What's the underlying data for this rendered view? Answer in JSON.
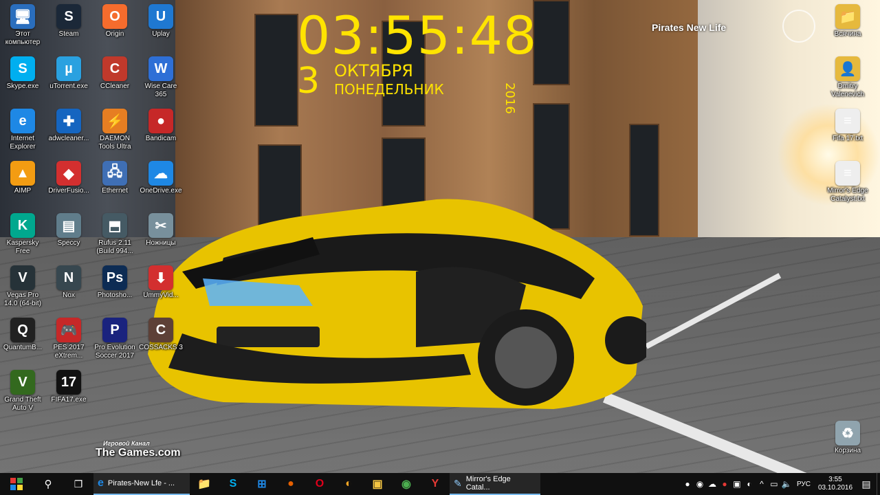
{
  "desktop": {
    "icons_left": [
      {
        "id": "this-pc",
        "label": "Этот компьютер",
        "glyph": "🖥",
        "color": "#2a6ebd"
      },
      {
        "id": "steam",
        "label": "Steam",
        "glyph": "S",
        "color": "#1b2838"
      },
      {
        "id": "origin",
        "label": "Origin",
        "glyph": "O",
        "color": "#f56c2d"
      },
      {
        "id": "uplay",
        "label": "Uplay",
        "glyph": "U",
        "color": "#1f78d1"
      },
      {
        "id": "skype",
        "label": "Skype.exe",
        "glyph": "S",
        "color": "#00aff0"
      },
      {
        "id": "utorrent",
        "label": "uTorrent.exe",
        "glyph": "µ",
        "color": "#2aa1e0"
      },
      {
        "id": "ccleaner",
        "label": "CCleaner",
        "glyph": "C",
        "color": "#c0392b"
      },
      {
        "id": "wisecare",
        "label": "Wise Care 365",
        "glyph": "W",
        "color": "#2e6fd6"
      },
      {
        "id": "ie",
        "label": "Internet Explorer",
        "glyph": "e",
        "color": "#1e88e5"
      },
      {
        "id": "adwcleaner",
        "label": "adwcleaner...",
        "glyph": "✚",
        "color": "#1565c0"
      },
      {
        "id": "daemon",
        "label": "DAEMON Tools Ultra",
        "glyph": "⚡",
        "color": "#e67e22"
      },
      {
        "id": "bandicam",
        "label": "Bandicam",
        "glyph": "●",
        "color": "#c62828"
      },
      {
        "id": "aimp",
        "label": "AIMP",
        "glyph": "▲",
        "color": "#f39c12"
      },
      {
        "id": "driverfusion",
        "label": "DriverFusio...",
        "glyph": "◆",
        "color": "#d32f2f"
      },
      {
        "id": "ethernet",
        "label": "Ethernet",
        "glyph": "🖧",
        "color": "#3f6fb5"
      },
      {
        "id": "onedrive",
        "label": "OneDrive.exe",
        "glyph": "☁",
        "color": "#1e88e5"
      },
      {
        "id": "kaspersky",
        "label": "Kaspersky Free",
        "glyph": "K",
        "color": "#00a88e"
      },
      {
        "id": "speccy",
        "label": "Speccy",
        "glyph": "▤",
        "color": "#607d8b"
      },
      {
        "id": "rufus",
        "label": "Rufus 2.11 (Build 994...",
        "glyph": "⬒",
        "color": "#455a64"
      },
      {
        "id": "scissors",
        "label": "Ножницы",
        "glyph": "✂",
        "color": "#78909c"
      },
      {
        "id": "vegas",
        "label": "Vegas Pro 14.0 (64-bit)",
        "glyph": "V",
        "color": "#263238"
      },
      {
        "id": "nox",
        "label": "Nox",
        "glyph": "N",
        "color": "#37474f"
      },
      {
        "id": "photoshop",
        "label": "Photosho...",
        "glyph": "Ps",
        "color": "#0d2c54"
      },
      {
        "id": "ummy",
        "label": "UmmyVid...",
        "glyph": "⬇",
        "color": "#d32f2f"
      },
      {
        "id": "quantum",
        "label": "QuantumB...",
        "glyph": "Q",
        "color": "#212121"
      },
      {
        "id": "pes2017",
        "label": "PES 2017 eXtrem...",
        "glyph": "🎮",
        "color": "#c62828"
      },
      {
        "id": "pes",
        "label": "Pro Evolution Soccer 2017",
        "glyph": "P",
        "color": "#1a237e"
      },
      {
        "id": "cossacks",
        "label": "COSSACKS 3",
        "glyph": "C",
        "color": "#5d4037"
      },
      {
        "id": "gta",
        "label": "Grand Theft Auto V",
        "glyph": "V",
        "color": "#33691e"
      },
      {
        "id": "fifa",
        "label": "FIFA17.exe",
        "glyph": "17",
        "color": "#111111"
      }
    ],
    "icons_right": [
      {
        "id": "vsyachina",
        "label": "Всячина",
        "glyph": "📁",
        "color": "#e6b93d"
      },
      {
        "id": "user-folder",
        "label": "Dmitry Valenevich",
        "glyph": "👤",
        "color": "#e6b93d"
      },
      {
        "id": "fifa-txt",
        "label": "Fifa 17.txt",
        "glyph": "≡",
        "color": "#eeeeee"
      },
      {
        "id": "mirrors-txt",
        "label": "Mirror's Edge Catalyst.txt",
        "glyph": "≡",
        "color": "#eeeeee"
      },
      {
        "id": "recycle",
        "label": "Корзина",
        "glyph": "♻",
        "color": "#90a4ae"
      }
    ]
  },
  "clock_widget": {
    "time": "03:55:48",
    "day": "3",
    "month": "ОКТЯБРЯ",
    "weekday": "ПОНЕДЕЛЬНИК",
    "year": "2016"
  },
  "overlay_text": {
    "pirates": "Pirates New Life",
    "watermark_small": "Игровой Канал",
    "watermark_big": "The Games.com"
  },
  "taskbar": {
    "tasks": [
      {
        "id": "pirates-task",
        "label": "Pirates-New Lfe - ...",
        "glyph": "e",
        "color": "#1e88e5"
      },
      {
        "id": "mirrors-task",
        "label": "Mirror's Edge Catal...",
        "glyph": "✎",
        "color": "#90caf9"
      }
    ],
    "pinned": [
      {
        "id": "explorer",
        "glyph": "📁",
        "color": "#f4c542"
      },
      {
        "id": "skype",
        "glyph": "S",
        "color": "#00aff0"
      },
      {
        "id": "store",
        "glyph": "⊞",
        "color": "#1e88e5"
      },
      {
        "id": "firefox",
        "glyph": "●",
        "color": "#e66000"
      },
      {
        "id": "opera",
        "glyph": "O",
        "color": "#e0001b"
      },
      {
        "id": "palette",
        "glyph": "◐",
        "color": "#f9a825"
      },
      {
        "id": "folder2",
        "glyph": "▣",
        "color": "#f4c542"
      },
      {
        "id": "chrome",
        "glyph": "◉",
        "color": "#4caf50"
      },
      {
        "id": "yandex",
        "glyph": "Y",
        "color": "#e53935"
      }
    ],
    "tray": {
      "language": "РУС",
      "time": "3:55",
      "date": "03.10.2016"
    }
  }
}
